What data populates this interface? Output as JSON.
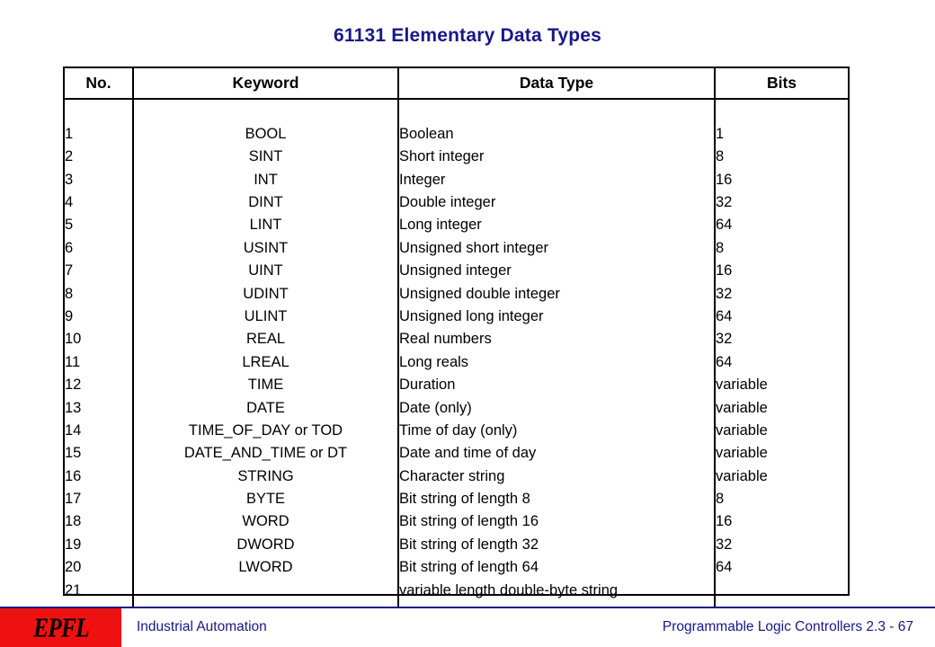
{
  "slide": {
    "title": "61131 Elementary Data Types",
    "title_color": "#181887"
  },
  "table": {
    "columns": [
      {
        "key": "no",
        "header": "No."
      },
      {
        "key": "kw",
        "header": "Keyword"
      },
      {
        "key": "type",
        "header": "Data Type"
      },
      {
        "key": "bits",
        "header": "Bits"
      }
    ],
    "rows": [
      {
        "no": "1",
        "kw": "BOOL",
        "type": "Boolean",
        "bits": "1"
      },
      {
        "no": "2",
        "kw": "SINT",
        "type": "Short integer",
        "bits": "8"
      },
      {
        "no": "3",
        "kw": "INT",
        "type": "Integer",
        "bits": "16"
      },
      {
        "no": "4",
        "kw": "DINT",
        "type": "Double integer",
        "bits": "32"
      },
      {
        "no": "5",
        "kw": "LINT",
        "type": "Long integer",
        "bits": "64"
      },
      {
        "no": "6",
        "kw": "USINT",
        "type": "Unsigned short integer",
        "bits": "8"
      },
      {
        "no": "7",
        "kw": "UINT",
        "type": "Unsigned integer",
        "bits": "16"
      },
      {
        "no": "8",
        "kw": "UDINT",
        "type": "Unsigned double integer",
        "bits": "32"
      },
      {
        "no": "9",
        "kw": "ULINT",
        "type": "Unsigned long integer",
        "bits": "64"
      },
      {
        "no": "10",
        "kw": "REAL",
        "type": "Real numbers",
        "bits": "32"
      },
      {
        "no": "11",
        "kw": "LREAL",
        "type": "Long reals",
        "bits": "64"
      },
      {
        "no": "12",
        "kw": "TIME",
        "type": "Duration",
        "bits": "variable"
      },
      {
        "no": "13",
        "kw": "DATE",
        "type": "Date (only)",
        "bits": "variable"
      },
      {
        "no": "14",
        "kw": "TIME_OF_DAY or TOD",
        "type": "Time of day (only)",
        "bits": "variable"
      },
      {
        "no": "15",
        "kw": "DATE_AND_TIME or DT",
        "type": "Date and time of day",
        "bits": "variable"
      },
      {
        "no": "16",
        "kw": "STRING",
        "type": "Character string",
        "bits": "variable"
      },
      {
        "no": "17",
        "kw": "BYTE",
        "type": "Bit string of length 8",
        "bits": "8"
      },
      {
        "no": "18",
        "kw": "WORD",
        "type": "Bit string of length 16",
        "bits": "16"
      },
      {
        "no": "19",
        "kw": "DWORD",
        "type": "Bit string of length 32",
        "bits": "32"
      },
      {
        "no": "20",
        "kw": "LWORD",
        "type": "Bit string of length 64",
        "bits": "64"
      },
      {
        "no": "21",
        "kw": "",
        "type": "variable length double-byte string",
        "bits": ""
      }
    ]
  },
  "footer": {
    "logo_text": "EPFL",
    "logo_color": "#ee1111",
    "left_text": "Industrial Automation",
    "right_text": "Programmable Logic Controllers 2.3 - 67",
    "text_color": "#181887"
  }
}
